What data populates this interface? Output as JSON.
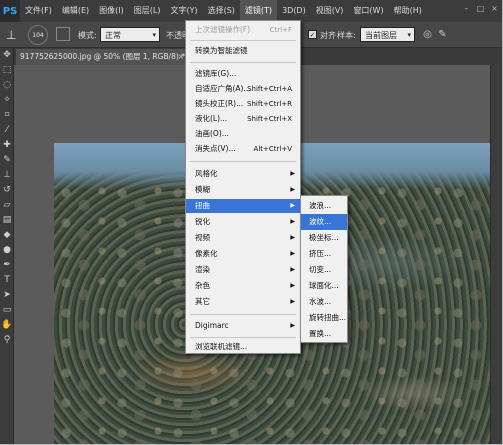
{
  "app": {
    "logo": "PS"
  },
  "menubar": {
    "items": [
      "文件(F)",
      "编辑(E)",
      "图像(I)",
      "图层(L)",
      "文字(Y)",
      "选择(S)",
      "滤镜(T)",
      "3D(D)",
      "视图(V)",
      "窗口(W)",
      "帮助(H)"
    ]
  },
  "window_controls": {
    "minimize": "–",
    "maximize": "□",
    "close": "×"
  },
  "options": {
    "brush_size": "104",
    "mode_label": "模式:",
    "mode_value": "正常",
    "opacity_label": "不透明",
    "align_label": "对齐",
    "sample_label": "样本:",
    "sample_value": "当前图层"
  },
  "document": {
    "tab_label": "917752625000.jpg @ 50% (图层 1, RGB/8) *",
    "close": "×"
  },
  "filter_menu": {
    "items": [
      {
        "label": "上次滤镜操作(F)",
        "shortcut": "Ctrl+F",
        "disabled": true
      },
      {
        "label": "转换为智能滤镜"
      },
      {
        "label": "滤镜库(G)..."
      },
      {
        "label": "自适应广角(A)...",
        "shortcut": "Shift+Ctrl+A"
      },
      {
        "label": "镜头校正(R)...",
        "shortcut": "Shift+Ctrl+R"
      },
      {
        "label": "液化(L)...",
        "shortcut": "Shift+Ctrl+X"
      },
      {
        "label": "油画(O)..."
      },
      {
        "label": "消失点(V)...",
        "shortcut": "Alt+Ctrl+V"
      },
      {
        "label": "风格化"
      },
      {
        "label": "模糊"
      },
      {
        "label": "扭曲",
        "highlighted": true
      },
      {
        "label": "锐化"
      },
      {
        "label": "视频"
      },
      {
        "label": "像素化"
      },
      {
        "label": "渲染"
      },
      {
        "label": "杂色"
      },
      {
        "label": "其它"
      },
      {
        "label": "Digimarc"
      },
      {
        "label": "浏览联机滤镜..."
      }
    ]
  },
  "distort_submenu": {
    "items": [
      {
        "label": "波浪..."
      },
      {
        "label": "波纹...",
        "highlighted": true
      },
      {
        "label": "极坐标..."
      },
      {
        "label": "挤压..."
      },
      {
        "label": "切变..."
      },
      {
        "label": "球面化..."
      },
      {
        "label": "水波..."
      },
      {
        "label": "旋转扭曲..."
      },
      {
        "label": "置换..."
      }
    ]
  },
  "colors": {
    "highlight": "#3875d7",
    "menubar": "#3c3c3c",
    "workspace": "#535353"
  }
}
